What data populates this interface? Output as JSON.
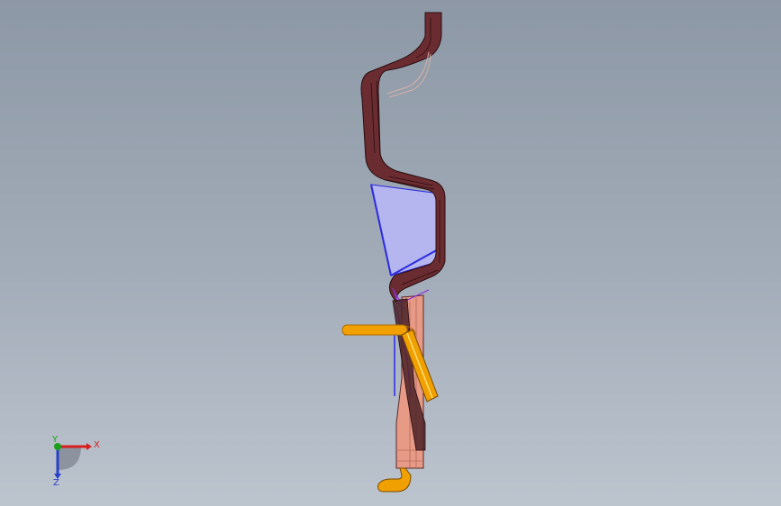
{
  "viewport": {
    "background_top": "#8d98a6",
    "background_bottom": "#bcc4ce"
  },
  "model": {
    "colors": {
      "shell_dark": "#4a2226",
      "shell_mid": "#7c3a3a",
      "core_salmon": "#e79a86",
      "cavity_fill": "#b5b5f0",
      "cavity_edge": "#2a2ae0",
      "cooling_pipe": "#f0a000",
      "edge_purple": "#8a2be2"
    }
  },
  "triad": {
    "x_label": "X",
    "y_label": "Y",
    "z_label": "Z",
    "x_color": "#d81e1e",
    "y_color": "#1aa01a",
    "z_color": "#2740c8"
  }
}
